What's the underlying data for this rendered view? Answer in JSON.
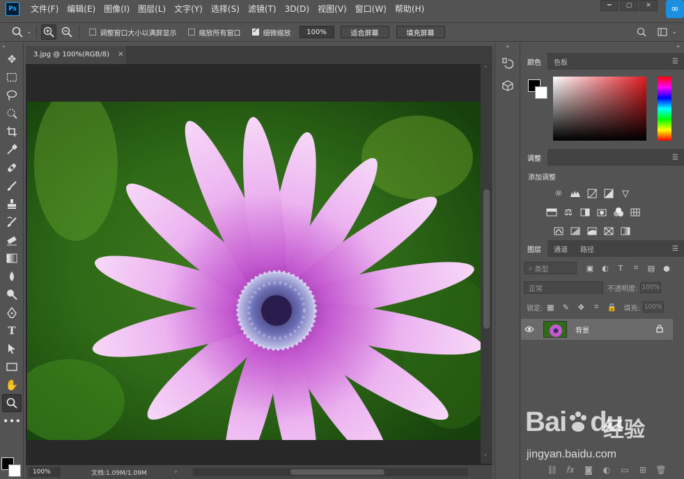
{
  "app": {
    "logo_text": "Ps"
  },
  "menu": [
    "文件(F)",
    "编辑(E)",
    "图像(I)",
    "图层(L)",
    "文字(Y)",
    "选择(S)",
    "滤镜(T)",
    "3D(D)",
    "视图(V)",
    "窗口(W)",
    "帮助(H)"
  ],
  "options_bar": {
    "fit_window": "调整窗口大小以满屏显示",
    "zoom_all": "缩放所有窗口",
    "scrubby_zoom": "细微缩放",
    "zoom_value": "100%",
    "fit_screen": "适合屏幕",
    "fill_screen": "填充屏幕",
    "fit_window_checked": false,
    "zoom_all_checked": false,
    "scrubby_zoom_checked": true
  },
  "document": {
    "tab_title": "3.jpg @ 100%(RGB/8)",
    "zoom": "100%",
    "doc_info": "文档:1.09M/1.09M"
  },
  "panels": {
    "color_tabs": [
      "颜色",
      "色板"
    ],
    "adjust_tab": "调整",
    "adjust_title": "添加调整",
    "layers_tabs": [
      "图层",
      "通道",
      "路径"
    ],
    "filter_kind": "类型",
    "blend_mode": "正常",
    "opacity_label": "不透明度:",
    "opacity_value": "100%",
    "lock_label": "锁定:",
    "fill_label": "填充:",
    "fill_value": "100%",
    "layer_name": "背景"
  },
  "colors": {
    "foreground": "#000000",
    "background": "#ffffff",
    "accent": "#31a8ff"
  },
  "watermark": {
    "brand": "Bai",
    "brand2": "du",
    "cn": "经验",
    "url": "jingyan.baidu.com"
  }
}
